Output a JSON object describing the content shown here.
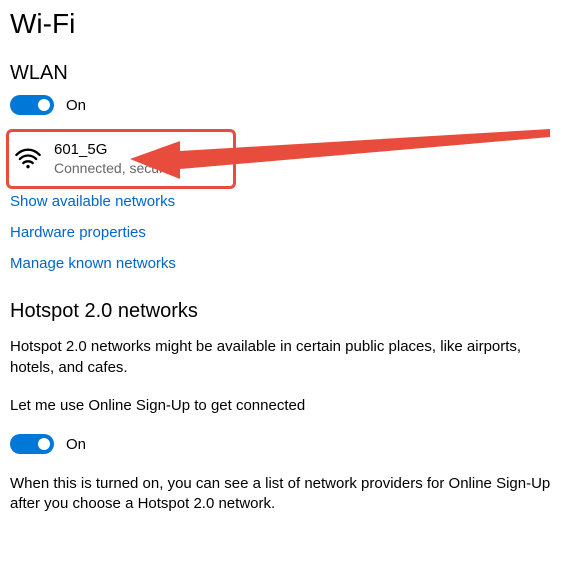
{
  "title": "Wi-Fi",
  "wlan": {
    "header": "WLAN",
    "toggle_state": "On",
    "network": {
      "name": "601_5G",
      "status": "Connected, secured"
    },
    "links": {
      "show_available": "Show available networks",
      "hardware_props": "Hardware properties",
      "manage_known": "Manage known networks"
    }
  },
  "hotspot": {
    "header": "Hotspot 2.0 networks",
    "description": "Hotspot 2.0 networks might be available in certain public places, like airports, hotels, and cafes.",
    "toggle_label": "Let me use Online Sign-Up to get connected",
    "toggle_state": "On",
    "note": "When this is turned on, you can see a list of network providers for Online Sign-Up after you choose a Hotspot 2.0 network."
  }
}
